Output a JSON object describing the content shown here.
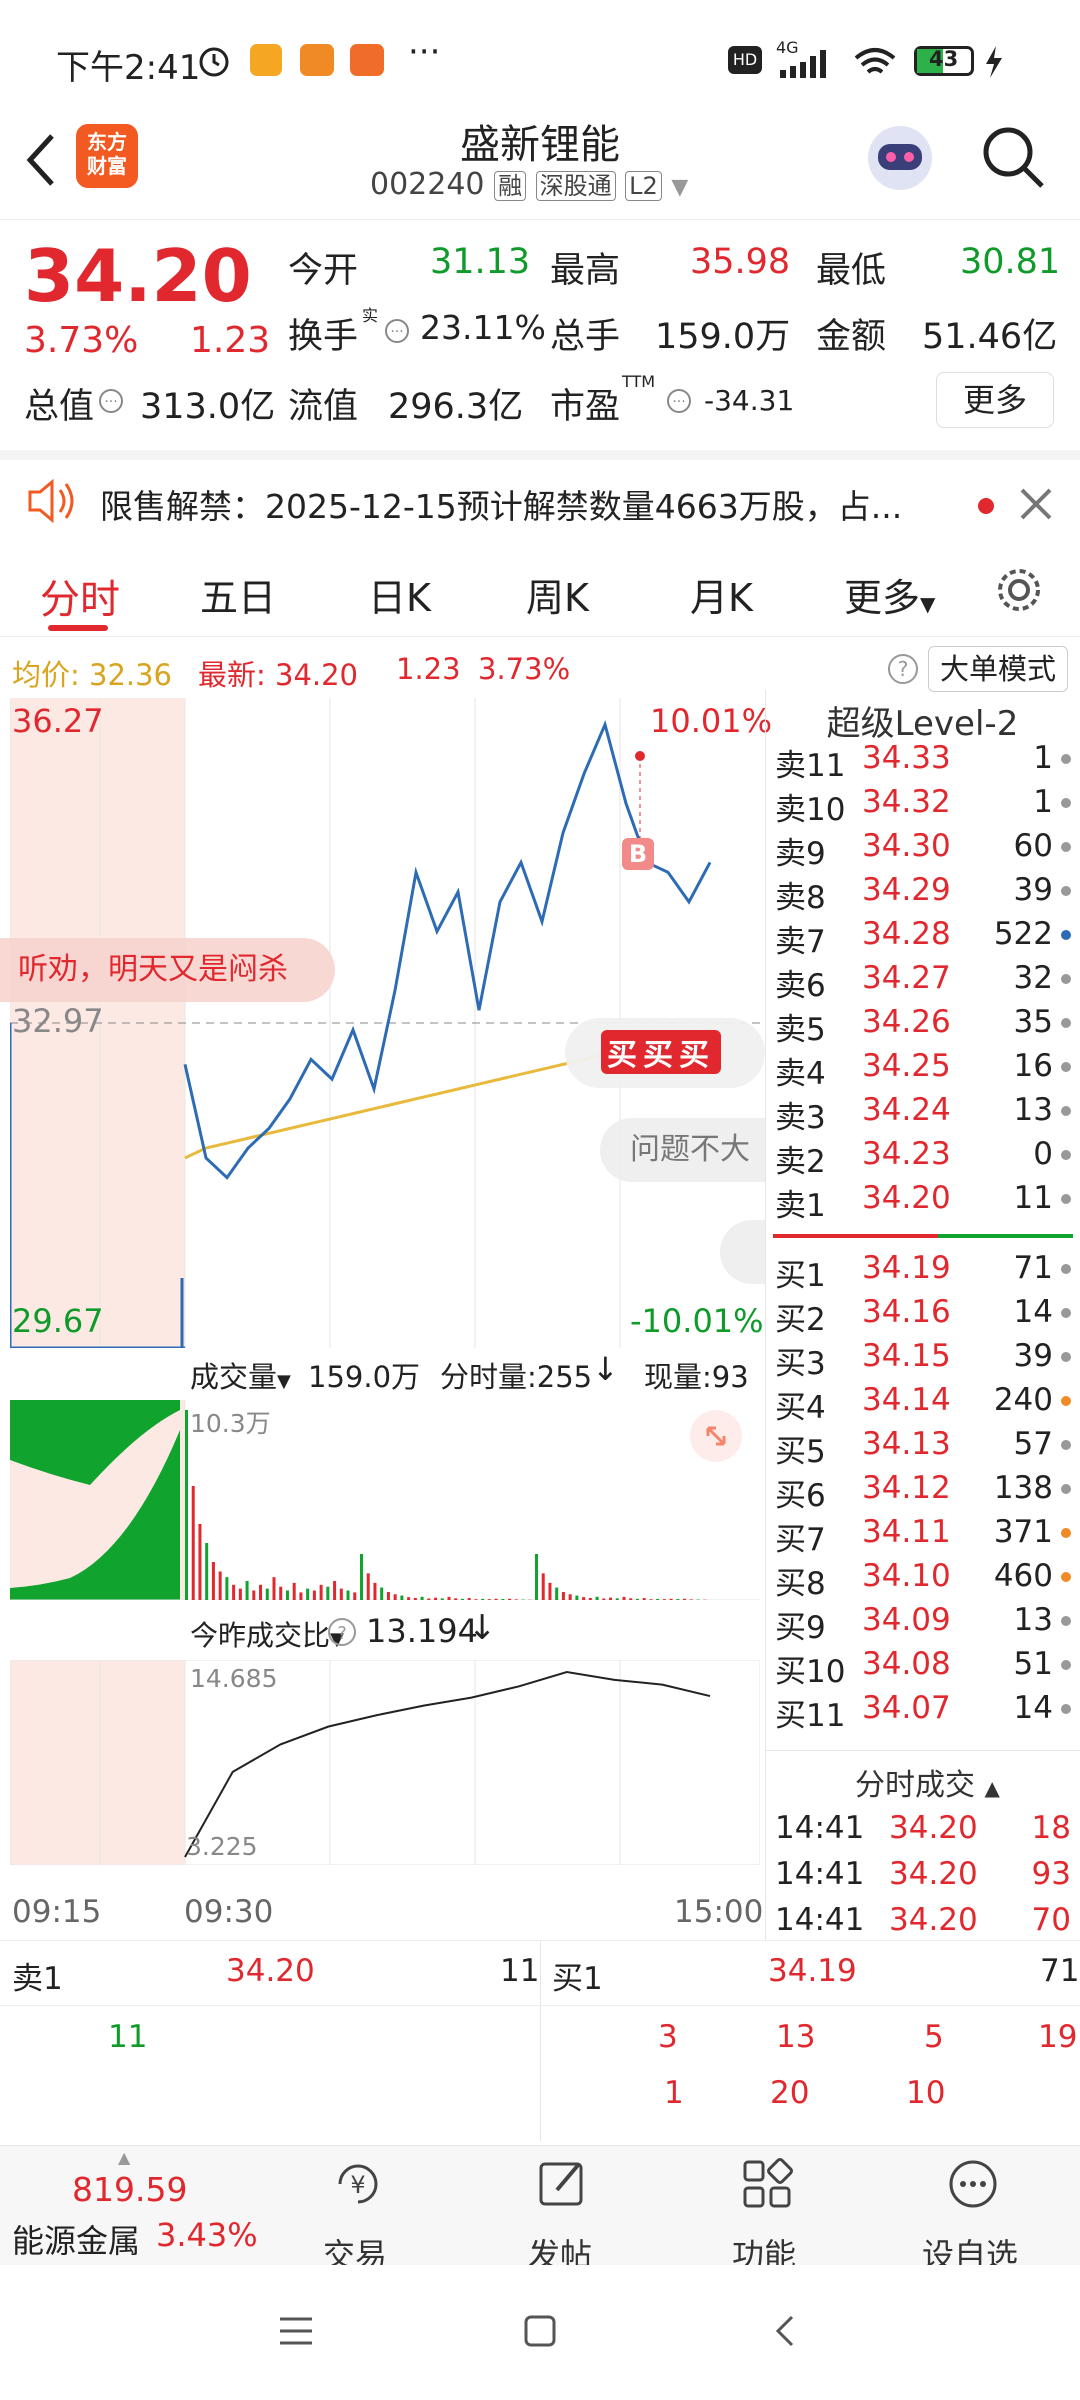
{
  "status": {
    "time": "下午2:41",
    "battery": "43",
    "net": "4G",
    "hd": "HD"
  },
  "header": {
    "logo_line1": "东方",
    "logo_line2": "财富",
    "title": "盛新锂能",
    "code": "002240",
    "badges": [
      "融",
      "深股通",
      "L2"
    ]
  },
  "quote": {
    "price": "34.20",
    "pct": "3.73%",
    "chg": "1.23",
    "fields": [
      {
        "label": "今开",
        "value": "31.13",
        "color": "green"
      },
      {
        "label": "最高",
        "value": "35.98",
        "color": "red"
      },
      {
        "label": "最低",
        "value": "30.81",
        "color": "green"
      },
      {
        "label": "换手",
        "sup": "实",
        "value": "23.11%",
        "color": "dark"
      },
      {
        "label": "总手",
        "value": "159.0万",
        "color": "dark"
      },
      {
        "label": "金额",
        "value": "51.46亿",
        "color": "dark"
      },
      {
        "label": "总值",
        "value": "313.0亿",
        "color": "dark"
      },
      {
        "label": "流值",
        "value": "296.3亿",
        "color": "dark"
      },
      {
        "label": "市盈",
        "sup": "TTM",
        "value": "-34.31",
        "color": "dark"
      }
    ],
    "more_label": "更多"
  },
  "notice": {
    "text": "限售解禁：2025-12-15预计解禁数量4663万股，占..."
  },
  "tabs": {
    "items": [
      "分时",
      "五日",
      "日K",
      "周K",
      "月K",
      "更多"
    ],
    "active": 0
  },
  "chart": {
    "avg_label": "均价: 32.36",
    "latest_label": "最新: 34.20",
    "chg": "1.23",
    "pct": "3.73%",
    "big_order_mode": "大单模式",
    "y_top": "36.27",
    "y_mid": "32.97",
    "y_bottom": "29.67",
    "pct_top": "10.01%",
    "pct_bottom": "-10.01%",
    "overlay_text": "听劝，明天又是闷杀",
    "buy_text": "买买买",
    "question_text": "问题不大",
    "b_marker": "B",
    "volume_label": "成交量",
    "volume_value": "159.0万",
    "minute_volume": "分时量:255",
    "current_volume": "现量:93",
    "volume_max": "10.3万",
    "ratio_label": "今昨成交比",
    "ratio_value": "13.194",
    "ratio_top": "14.685",
    "ratio_bottom": "3.225",
    "time_labels": [
      "09:15",
      "09:30",
      "15:00"
    ],
    "colors": {
      "price": "#2d6cb5",
      "avg": "#e8b93a",
      "up": "#e0282e",
      "down": "#0f9b2a"
    },
    "price_range": [
      29.67,
      36.27
    ]
  },
  "chart_data": {
    "type": "line",
    "title": "",
    "series": [
      {
        "values": [
          32.55,
          31.6,
          31.4,
          31.7,
          31.9,
          32.2,
          32.6,
          32.4,
          32.9,
          32.3,
          33.3,
          34.5,
          33.9,
          34.3,
          33.1,
          34.2,
          34.6,
          34.0,
          34.9,
          35.5,
          36.0,
          35.2,
          34.6,
          34.5,
          34.2,
          34.6
        ]
      }
    ],
    "avg_values": [
      31.6,
      31.7,
      31.75,
      31.8,
      31.85,
      31.9,
      31.95,
      32.0,
      32.05,
      32.1,
      32.15,
      32.2,
      32.25,
      32.3,
      32.35,
      32.4,
      32.45,
      32.5,
      32.55,
      32.6,
      32.65,
      32.7,
      32.75,
      32.8,
      32.85,
      32.9
    ],
    "ylim": [
      29.67,
      36.27
    ],
    "yticks": [
      "36.27",
      "32.97",
      "29.67"
    ],
    "xticks": [
      "09:15",
      "09:30",
      "15:00"
    ],
    "volume": [
      100,
      60,
      40,
      30,
      20,
      15,
      12,
      8,
      6,
      10,
      5,
      8,
      6,
      12,
      7,
      5,
      9,
      4,
      6,
      5,
      8,
      7,
      10,
      6,
      5,
      4
    ],
    "ratio": [
      3.225,
      8.5,
      10.2,
      11.3,
      12.0,
      12.6,
      13.1,
      13.8,
      14.685,
      14.2,
      13.9,
      13.194
    ]
  },
  "level2": {
    "title": "超级Level-2",
    "sells": [
      {
        "label": "卖11",
        "price": "34.33",
        "vol": "1"
      },
      {
        "label": "卖10",
        "price": "34.32",
        "vol": "1"
      },
      {
        "label": "卖9",
        "price": "34.30",
        "vol": "60"
      },
      {
        "label": "卖8",
        "price": "34.29",
        "vol": "39"
      },
      {
        "label": "卖7",
        "price": "34.28",
        "vol": "522"
      },
      {
        "label": "卖6",
        "price": "34.27",
        "vol": "32"
      },
      {
        "label": "卖5",
        "price": "34.26",
        "vol": "35"
      },
      {
        "label": "卖4",
        "price": "34.25",
        "vol": "16"
      },
      {
        "label": "卖3",
        "price": "34.24",
        "vol": "13"
      },
      {
        "label": "卖2",
        "price": "34.23",
        "vol": "0"
      },
      {
        "label": "卖1",
        "price": "34.20",
        "vol": "11"
      }
    ],
    "buys": [
      {
        "label": "买1",
        "price": "34.19",
        "vol": "71"
      },
      {
        "label": "买2",
        "price": "34.16",
        "vol": "14"
      },
      {
        "label": "买3",
        "price": "34.15",
        "vol": "39"
      },
      {
        "label": "买4",
        "price": "34.14",
        "vol": "240"
      },
      {
        "label": "买5",
        "price": "34.13",
        "vol": "57"
      },
      {
        "label": "买6",
        "price": "34.12",
        "vol": "138"
      },
      {
        "label": "买7",
        "price": "34.11",
        "vol": "371"
      },
      {
        "label": "买8",
        "price": "34.10",
        "vol": "460"
      },
      {
        "label": "买9",
        "price": "34.09",
        "vol": "13"
      },
      {
        "label": "买10",
        "price": "34.08",
        "vol": "51"
      },
      {
        "label": "买11",
        "price": "34.07",
        "vol": "14"
      }
    ],
    "trades_title": "分时成交",
    "trades": [
      {
        "time": "14:41",
        "price": "34.20",
        "vol": "18"
      },
      {
        "time": "14:41",
        "price": "34.20",
        "vol": "93"
      },
      {
        "time": "14:41",
        "price": "34.20",
        "vol": "70"
      }
    ]
  },
  "bottombook": {
    "sell_label": "卖1",
    "sell_price": "34.20",
    "sell_vol": "11",
    "buy_label": "买1",
    "buy_price": "34.19",
    "buy_vol": "71",
    "sell_queue": [
      "11"
    ],
    "buy_queue": [
      "3",
      "13",
      "5",
      "19",
      "1",
      "20",
      "10"
    ]
  },
  "bottomnav": {
    "index_value": "819.59",
    "index_name": "能源金属",
    "index_pct": "3.43%",
    "items": [
      "交易",
      "发帖",
      "功能",
      "设自选"
    ]
  }
}
